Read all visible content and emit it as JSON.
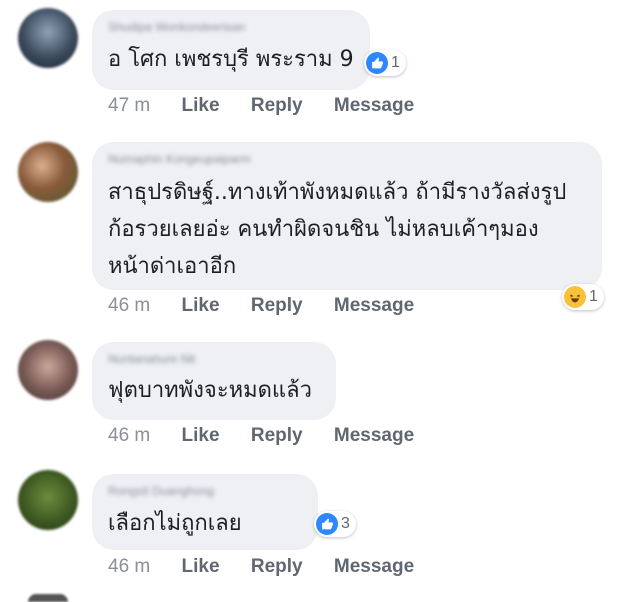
{
  "comments": [
    {
      "author": "Shudipa Wonkondeerisan",
      "text": [
        "อ โศก เพชรบุรี พระราม 9"
      ],
      "time": "47 m",
      "like": "Like",
      "reply": "Reply",
      "message": "Message",
      "reaction": {
        "type": "like-icon",
        "count": "1"
      }
    },
    {
      "author": "Numaphin Kongeupaiparm",
      "text": [
        "สาธุปรดิษฐ์..ทางเท้าพังหมดแล้ว ถ้ามีรางวัลส่งรูป",
        "ก้อรวยเลยอ่ะ คนทำผิดจนชิน ไม่หลบเค้าๆมอง",
        "หน้าด่าเอาอีก"
      ],
      "time": "46 m",
      "like": "Like",
      "reply": "Reply",
      "message": "Message",
      "reaction": {
        "type": "haha-icon",
        "count": "1"
      }
    },
    {
      "author": "Nuntanahure Nit",
      "text": [
        "ฟุตบาทพังจะหมดแล้ว"
      ],
      "time": "46 m",
      "like": "Like",
      "reply": "Reply",
      "message": "Message"
    },
    {
      "author": "Rongsit Duanghong",
      "text": [
        "เลือกไม่ถูกเลย"
      ],
      "time": "46 m",
      "like": "Like",
      "reply": "Reply",
      "message": "Message",
      "reaction": {
        "type": "like-icon",
        "count": "3"
      }
    }
  ],
  "colors": {
    "bubble": "#eef0f4",
    "like_blue": "#2d88ff",
    "haha_yellow": "#f7c23a",
    "meta_text": "#606770"
  }
}
